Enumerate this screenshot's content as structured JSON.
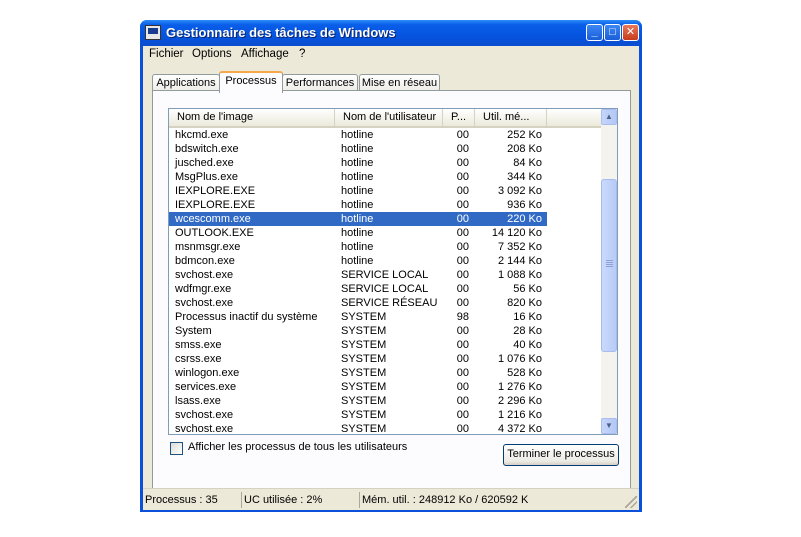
{
  "window": {
    "title": "Gestionnaire des tâches de Windows"
  },
  "titlebar_buttons": {
    "minimize": "_",
    "maximize": "□",
    "close": "✕"
  },
  "menu": [
    "Fichier",
    "Options",
    "Affichage",
    "?"
  ],
  "tabs": [
    "Applications",
    "Processus",
    "Performances",
    "Mise en réseau"
  ],
  "active_tab": "Processus",
  "columns": [
    "Nom de l'image",
    "Nom de l'utilisateur",
    "P...",
    "Util. mé..."
  ],
  "processes": [
    {
      "name": "hkcmd.exe",
      "user": "hotline",
      "cpu": "00",
      "mem": "252 Ko"
    },
    {
      "name": "bdswitch.exe",
      "user": "hotline",
      "cpu": "00",
      "mem": "208 Ko"
    },
    {
      "name": "jusched.exe",
      "user": "hotline",
      "cpu": "00",
      "mem": "84 Ko"
    },
    {
      "name": "MsgPlus.exe",
      "user": "hotline",
      "cpu": "00",
      "mem": "344 Ko"
    },
    {
      "name": "IEXPLORE.EXE",
      "user": "hotline",
      "cpu": "00",
      "mem": "3 092 Ko"
    },
    {
      "name": "IEXPLORE.EXE",
      "user": "hotline",
      "cpu": "00",
      "mem": "936 Ko"
    },
    {
      "name": "wcescomm.exe",
      "user": "hotline",
      "cpu": "00",
      "mem": "220 Ko",
      "selected": true
    },
    {
      "name": "OUTLOOK.EXE",
      "user": "hotline",
      "cpu": "00",
      "mem": "14 120 Ko"
    },
    {
      "name": "msnmsgr.exe",
      "user": "hotline",
      "cpu": "00",
      "mem": "7 352 Ko"
    },
    {
      "name": "bdmcon.exe",
      "user": "hotline",
      "cpu": "00",
      "mem": "2 144 Ko"
    },
    {
      "name": "svchost.exe",
      "user": "SERVICE LOCAL",
      "cpu": "00",
      "mem": "1 088 Ko"
    },
    {
      "name": "wdfmgr.exe",
      "user": "SERVICE LOCAL",
      "cpu": "00",
      "mem": "56 Ko"
    },
    {
      "name": "svchost.exe",
      "user": "SERVICE RÉSEAU",
      "cpu": "00",
      "mem": "820 Ko"
    },
    {
      "name": "Processus inactif du système",
      "user": "SYSTEM",
      "cpu": "98",
      "mem": "16 Ko"
    },
    {
      "name": "System",
      "user": "SYSTEM",
      "cpu": "00",
      "mem": "28 Ko"
    },
    {
      "name": "smss.exe",
      "user": "SYSTEM",
      "cpu": "00",
      "mem": "40 Ko"
    },
    {
      "name": "csrss.exe",
      "user": "SYSTEM",
      "cpu": "00",
      "mem": "1 076 Ko"
    },
    {
      "name": "winlogon.exe",
      "user": "SYSTEM",
      "cpu": "00",
      "mem": "528 Ko"
    },
    {
      "name": "services.exe",
      "user": "SYSTEM",
      "cpu": "00",
      "mem": "1 276 Ko"
    },
    {
      "name": "lsass.exe",
      "user": "SYSTEM",
      "cpu": "00",
      "mem": "2 296 Ko"
    },
    {
      "name": "svchost.exe",
      "user": "SYSTEM",
      "cpu": "00",
      "mem": "1 216 Ko"
    },
    {
      "name": "svchost.exe",
      "user": "SYSTEM",
      "cpu": "00",
      "mem": "4 372 Ko"
    }
  ],
  "show_all_users": {
    "label": "Afficher les processus de tous les utilisateurs",
    "checked": false
  },
  "end_process_button": "Terminer le processus",
  "status": {
    "processes": "Processus : 35",
    "cpu": "UC utilisée : 2%",
    "memory": "Mém. util. : 248912 Ko / 620592 K"
  },
  "colors": {
    "titlebar": "#0a5ee8",
    "selection": "#316ac5",
    "face": "#ece9d8"
  }
}
